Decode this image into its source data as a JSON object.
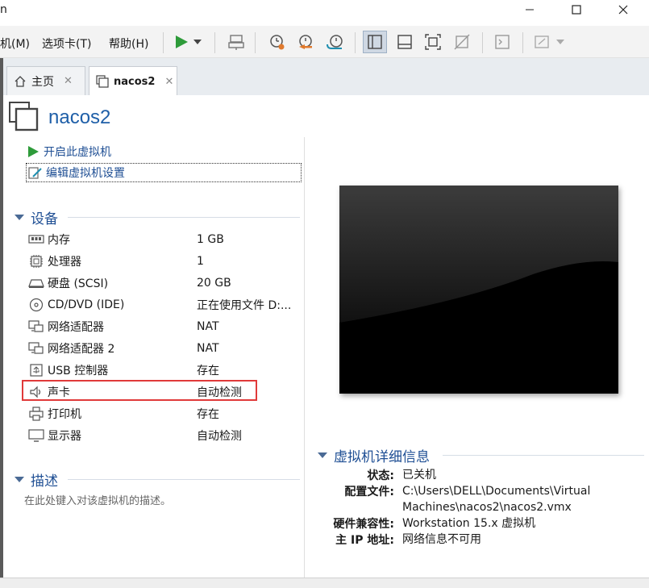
{
  "window": {
    "title_fragment": "n",
    "controls": {
      "minimize": "—",
      "maximize": "☐",
      "close": "✕"
    }
  },
  "menu": [
    {
      "label": "机(M)"
    },
    {
      "label": "选项卡(T)"
    },
    {
      "label": "帮助(H)"
    }
  ],
  "toolbar": {
    "icons": [
      "play-icon",
      "dropdown-icon",
      "send-ctrl-alt-del-icon",
      "snapshot-icon",
      "revert-snapshot-icon",
      "snapshot-manager-icon",
      "library-view-icon",
      "console-view-icon",
      "fullscreen-icon",
      "unity-icon",
      "terminal-icon",
      "stretch-icon"
    ],
    "accent": "#2e9b3a"
  },
  "tabs": [
    {
      "label": "主页",
      "icon": "home-icon",
      "close": "✕",
      "active": false
    },
    {
      "label": "nacos2",
      "icon": "vm-icon",
      "close": "✕",
      "active": true
    }
  ],
  "vm": {
    "name": "nacos2"
  },
  "actions": [
    {
      "label": "开启此虚拟机",
      "icon": "play-icon"
    },
    {
      "label": "编辑虚拟机设置",
      "icon": "edit-settings-icon"
    }
  ],
  "devices_section": {
    "title": "设备",
    "rows": [
      {
        "name": "内存",
        "value": "1 GB",
        "icon": "memory-icon"
      },
      {
        "name": "处理器",
        "value": "1",
        "icon": "processor-icon"
      },
      {
        "name": "硬盘 (SCSI)",
        "value": "20 GB",
        "icon": "harddisk-icon"
      },
      {
        "name": "CD/DVD (IDE)",
        "value": "正在使用文件 D:...",
        "icon": "cdrom-icon"
      },
      {
        "name": "网络适配器",
        "value": "NAT",
        "icon": "network-icon"
      },
      {
        "name": "网络适配器 2",
        "value": "NAT",
        "icon": "network-icon"
      },
      {
        "name": "USB 控制器",
        "value": "存在",
        "icon": "usb-icon"
      },
      {
        "name": "声卡",
        "value": "自动检测",
        "icon": "sound-icon"
      },
      {
        "name": "打印机",
        "value": "存在",
        "icon": "printer-icon"
      },
      {
        "name": "显示器",
        "value": "自动检测",
        "icon": "display-icon"
      }
    ]
  },
  "description_section": {
    "title": "描述",
    "placeholder": "在此处键入对该虚拟机的描述。"
  },
  "details_section": {
    "title": "虚拟机详细信息",
    "rows": [
      {
        "key": "状态:",
        "value": "已关机"
      },
      {
        "key": "配置文件:",
        "value": "C:\\Users\\DELL\\Documents\\Virtual Machines\\nacos2\\nacos2.vmx"
      },
      {
        "key": "硬件兼容性:",
        "value": "Workstation 15.x 虚拟机"
      },
      {
        "key": "主 IP 地址:",
        "value": "网络信息不可用"
      }
    ]
  },
  "colors": {
    "link": "#1f4f94",
    "title": "#1f5fa8",
    "highlight": "#e03a3a"
  }
}
